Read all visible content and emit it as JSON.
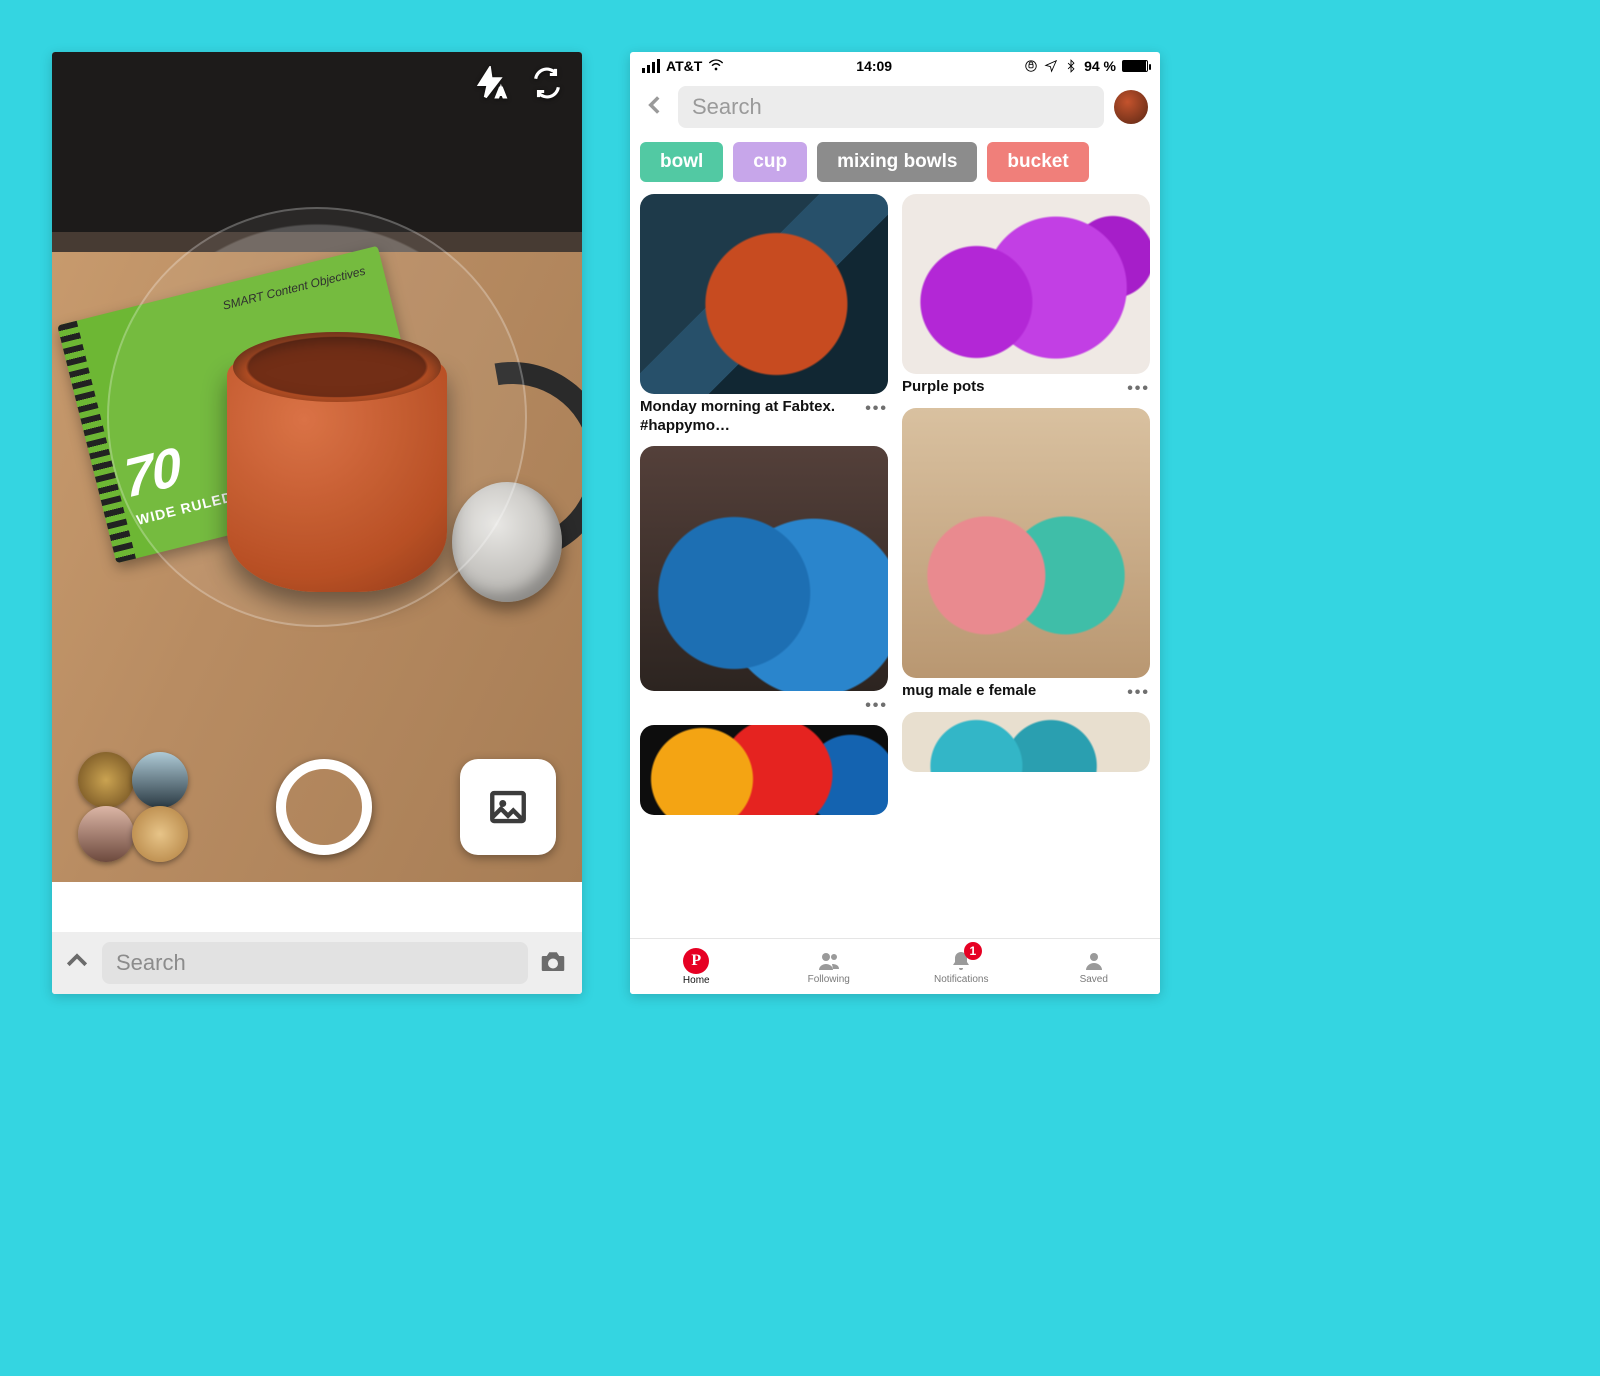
{
  "left": {
    "search_placeholder": "Search",
    "notebook": {
      "big": "70",
      "sub": "WIDE RULED",
      "small": "SMART Content Objectives"
    }
  },
  "right": {
    "statusbar": {
      "carrier": "AT&T",
      "time": "14:09",
      "battery": "94 %"
    },
    "search_placeholder": "Search",
    "chips": [
      {
        "label": "bowl",
        "color": "#52c9a3"
      },
      {
        "label": "cup",
        "color": "#c7a6ea"
      },
      {
        "label": "mixing bowls",
        "color": "#8c8c8c"
      },
      {
        "label": "bucket",
        "color": "#f07f7a"
      }
    ],
    "results": {
      "col1": [
        {
          "title": "Monday morning at Fabtex.  #happymo…",
          "cls": "redcup"
        },
        {
          "title": "",
          "cls": "bluebuckets"
        },
        {
          "title": "",
          "cls": "colorbuckets"
        }
      ],
      "col2": [
        {
          "title": "Purple pots",
          "cls": "purple"
        },
        {
          "title": "mug male e female",
          "cls": "mugs"
        },
        {
          "title": "",
          "cls": "partial"
        }
      ]
    },
    "tabs": {
      "home": "Home",
      "following": "Following",
      "notifications": "Notifications",
      "notifications_badge": "1",
      "saved": "Saved"
    }
  }
}
